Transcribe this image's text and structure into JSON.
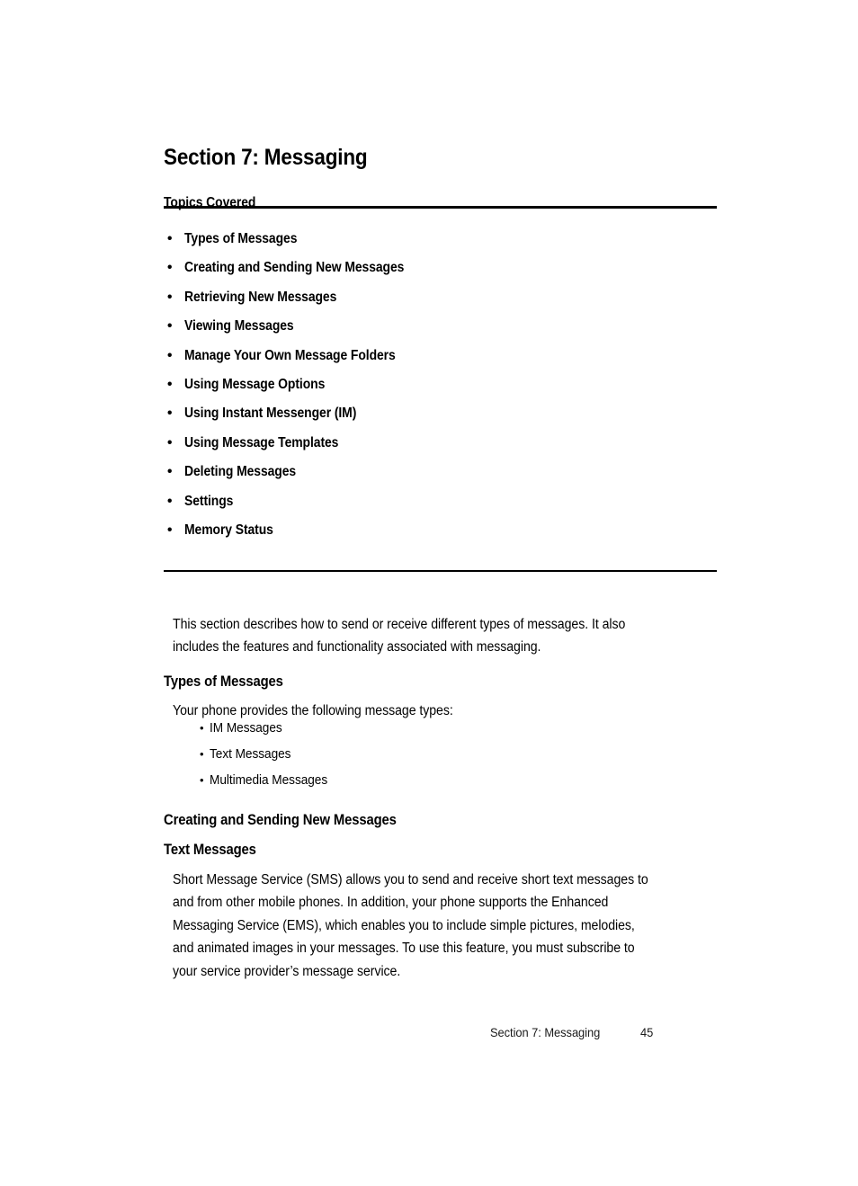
{
  "document": {
    "background_color": "#ffffff",
    "text_color": "#000000"
  },
  "section_title": "Section 7: Messaging",
  "topics": {
    "heading": "Topics Covered",
    "bullet_glyph": "•",
    "items": [
      {
        "label": "Types of Messages"
      },
      {
        "label": "Creating and Sending New Messages"
      },
      {
        "label": "Retrieving New Messages"
      },
      {
        "label": "Viewing Messages"
      },
      {
        "label": "Manage Your Own Message Folders"
      },
      {
        "label": "Using Message Options"
      },
      {
        "label": "Using Instant Messenger (IM)"
      },
      {
        "label": "Using Message Templates"
      },
      {
        "label": "Deleting Messages"
      },
      {
        "label": "Settings"
      },
      {
        "label": "Memory Status"
      }
    ]
  },
  "intro": {
    "lines": [
      "This section describes how to send or receive different types of messages. It also",
      "includes the features and functionality associated with messaging."
    ]
  },
  "types_of_messages": {
    "heading": "Types of Messages",
    "lead": "Your phone provides the following message types:",
    "bullet_glyph": "•",
    "items": [
      {
        "label": "IM Messages"
      },
      {
        "label": "Text Messages"
      },
      {
        "label": "Multimedia Messages"
      }
    ]
  },
  "creating_heading": "Creating and Sending New Messages",
  "text_messages": {
    "heading": "Text Messages",
    "lines": [
      "Short Message Service (SMS) allows you to send and receive short text messages to",
      "and from other mobile phones. In addition, your phone supports the Enhanced",
      "Messaging Service (EMS), which enables you to include simple pictures, melodies,",
      "and animated images in your messages. To use this feature, you must subscribe to",
      "your service provider’s message service."
    ]
  },
  "footer": {
    "text": "Section 7: Messaging",
    "page_number": "45"
  }
}
